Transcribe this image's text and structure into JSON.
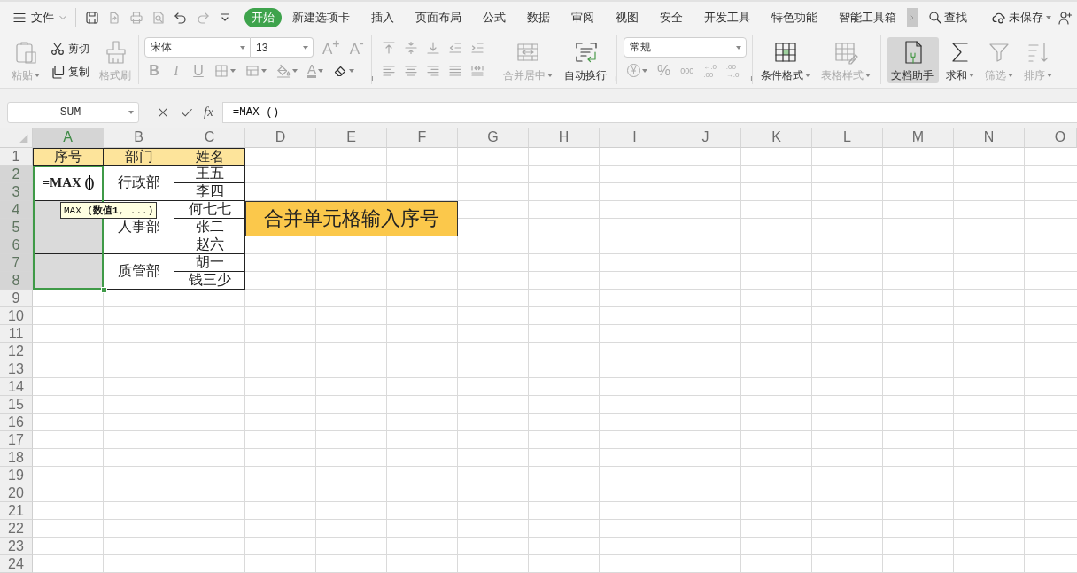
{
  "menu_bar": {
    "file_menu": "文件",
    "quick_access": [
      {
        "kind": "save",
        "disabled": false
      },
      {
        "kind": "export",
        "disabled": true
      },
      {
        "kind": "print",
        "disabled": true
      },
      {
        "kind": "preview",
        "disabled": true
      },
      {
        "kind": "undo",
        "disabled": false
      },
      {
        "kind": "redo",
        "disabled": true
      },
      {
        "kind": "customize",
        "disabled": false
      }
    ],
    "tabs": [
      {
        "label": "开始",
        "selected": true
      },
      {
        "label": "新建选项卡",
        "selected": false
      },
      {
        "label": "插入",
        "selected": false
      },
      {
        "label": "页面布局",
        "selected": false
      },
      {
        "label": "公式",
        "selected": false
      },
      {
        "label": "数据",
        "selected": false
      },
      {
        "label": "审阅",
        "selected": false
      },
      {
        "label": "视图",
        "selected": false
      },
      {
        "label": "安全",
        "selected": false
      },
      {
        "label": "开发工具",
        "selected": false
      },
      {
        "label": "特色功能",
        "selected": false
      },
      {
        "label": "智能工具箱",
        "selected": false
      }
    ],
    "search": "查找",
    "save_status": "未保存"
  },
  "ribbon": [
    {
      "kind": "clipboard",
      "items": [
        {
          "kind": "paste",
          "label": "粘贴",
          "disabled": true,
          "dropdown": true
        },
        {
          "kind": "cut",
          "label": "剪切",
          "disabled": false,
          "dropdown": false
        },
        {
          "kind": "copy",
          "label": "复制",
          "disabled": false,
          "dropdown": false
        },
        {
          "kind": "format_painter",
          "label": "格式刷",
          "disabled": true,
          "dropdown": false
        }
      ]
    },
    {
      "kind": "font",
      "font_name": "宋体",
      "font_size": "13",
      "sizing": [
        {
          "kind": "grow",
          "label": "A$^{+}$",
          "disabled": true,
          "dropdown": false
        },
        {
          "kind": "shrink",
          "label": "A$^{-}$",
          "disabled": true,
          "dropdown": false
        }
      ],
      "items": [
        {
          "kind": "bold",
          "label": "B",
          "disabled": true,
          "dropdown": false
        },
        {
          "kind": "italic",
          "label": "I",
          "disabled": true,
          "dropdown": false
        },
        {
          "kind": "underline",
          "label": "U",
          "disabled": true,
          "dropdown": false
        },
        {
          "kind": "borders",
          "disabled": true,
          "dropdown": true
        },
        {
          "kind": "cell_style",
          "disabled": true,
          "dropdown": true
        },
        {
          "kind": "fill",
          "disabled": true,
          "dropdown": true
        },
        {
          "kind": "font_color",
          "label": "A",
          "disabled": true,
          "dropdown": true
        },
        {
          "kind": "clear",
          "disabled": false,
          "dropdown": true
        }
      ]
    },
    {
      "kind": "alignment",
      "items": [
        {
          "kind": "top",
          "disabled": true
        },
        {
          "kind": "middle",
          "disabled": true
        },
        {
          "kind": "bottom",
          "disabled": true
        },
        {
          "kind": "outdent",
          "disabled": true
        },
        {
          "kind": "indent",
          "disabled": true
        },
        {
          "kind": "left",
          "disabled": true
        },
        {
          "kind": "center",
          "disabled": true
        },
        {
          "kind": "right",
          "disabled": true
        },
        {
          "kind": "justify",
          "disabled": true
        },
        {
          "kind": "distribute",
          "disabled": true
        }
      ],
      "buttons": [
        {
          "kind": "merge",
          "label": "合并居中",
          "disabled": true,
          "dropdown": true,
          "highlighted": false
        },
        {
          "kind": "wrap",
          "label": "自动换行",
          "disabled": false,
          "dropdown": false,
          "highlighted": false
        }
      ]
    },
    {
      "kind": "number",
      "format": "常规",
      "items": [
        {
          "kind": "currency",
          "label": "¥",
          "disabled": true,
          "dropdown": true
        },
        {
          "kind": "percent",
          "label": "%",
          "disabled": true,
          "dropdown": false
        },
        {
          "kind": "thousands",
          "label": "000",
          "disabled": true,
          "dropdown": false
        },
        {
          "kind": "add_decimal",
          "label": "←.0\n.00",
          "disabled": true,
          "dropdown": false
        },
        {
          "kind": "remove_decimal",
          "label": ".00\n→.0",
          "disabled": true,
          "dropdown": false
        }
      ]
    },
    {
      "kind": "buttons",
      "buttons": [
        {
          "kind": "conditional_format",
          "label": "条件格式",
          "disabled": false,
          "dropdown": true,
          "highlighted": false
        },
        {
          "kind": "table_style",
          "label": "表格样式",
          "disabled": true,
          "dropdown": true,
          "highlighted": false
        }
      ]
    },
    {
      "kind": "buttons",
      "buttons": [
        {
          "kind": "doc_assistant",
          "label": "文档助手",
          "disabled": false,
          "dropdown": false,
          "highlighted": true
        },
        {
          "kind": "sum",
          "label": "求和",
          "disabled": false,
          "dropdown": true,
          "highlighted": false
        },
        {
          "kind": "filter",
          "label": "筛选",
          "disabled": true,
          "dropdown": true,
          "highlighted": false
        },
        {
          "kind": "sort",
          "label": "排序",
          "disabled": true,
          "dropdown": true,
          "highlighted": false
        }
      ]
    }
  ],
  "formula_bar": {
    "name_box": "SUM",
    "function_label": "fx",
    "formula": "=MAX ()"
  },
  "sheet": {
    "columns": [
      {
        "label": "A",
        "selected": true
      },
      {
        "label": "B",
        "selected": false
      },
      {
        "label": "C",
        "selected": false
      },
      {
        "label": "D",
        "selected": false
      },
      {
        "label": "E",
        "selected": false
      },
      {
        "label": "F",
        "selected": false
      },
      {
        "label": "G",
        "selected": false
      },
      {
        "label": "H",
        "selected": false
      },
      {
        "label": "I",
        "selected": false
      },
      {
        "label": "J",
        "selected": false
      },
      {
        "label": "K",
        "selected": false
      },
      {
        "label": "L",
        "selected": false
      },
      {
        "label": "M",
        "selected": false
      },
      {
        "label": "N",
        "selected": false
      },
      {
        "label": "O",
        "selected": false
      }
    ],
    "rows": [
      {
        "label": "1",
        "selected": false
      },
      {
        "label": "2",
        "selected": true
      },
      {
        "label": "3",
        "selected": true
      },
      {
        "label": "4",
        "selected": true
      },
      {
        "label": "5",
        "selected": true
      },
      {
        "label": "6",
        "selected": true
      },
      {
        "label": "7",
        "selected": true
      },
      {
        "label": "8",
        "selected": true
      },
      {
        "label": "9",
        "selected": false
      },
      {
        "label": "10",
        "selected": false
      },
      {
        "label": "11",
        "selected": false
      },
      {
        "label": "12",
        "selected": false
      },
      {
        "label": "13",
        "selected": false
      },
      {
        "label": "14",
        "selected": false
      },
      {
        "label": "15",
        "selected": false
      },
      {
        "label": "16",
        "selected": false
      },
      {
        "label": "17",
        "selected": false
      },
      {
        "label": "18",
        "selected": false
      },
      {
        "label": "19",
        "selected": false
      },
      {
        "label": "20",
        "selected": false
      },
      {
        "label": "21",
        "selected": false
      },
      {
        "label": "22",
        "selected": false
      },
      {
        "label": "23",
        "selected": false
      },
      {
        "label": "24",
        "selected": false
      }
    ],
    "table": {
      "headers": [
        "序号",
        "部门",
        "姓名"
      ],
      "groups": [
        {
          "number": {
            "value": "=MAX ()",
            "active": true
          },
          "department": "行政部",
          "names": [
            "王五",
            "李四"
          ]
        },
        {
          "number": {
            "active": false
          },
          "department": "人事部",
          "names": [
            "何七七",
            "张二",
            "赵六"
          ]
        },
        {
          "number": {
            "active": false
          },
          "department": "质管部",
          "names": [
            "胡一",
            "钱三少"
          ]
        }
      ]
    },
    "note": "合并单元格输入序号",
    "tooltip": "MAX (**数值1**, ...)"
  }
}
